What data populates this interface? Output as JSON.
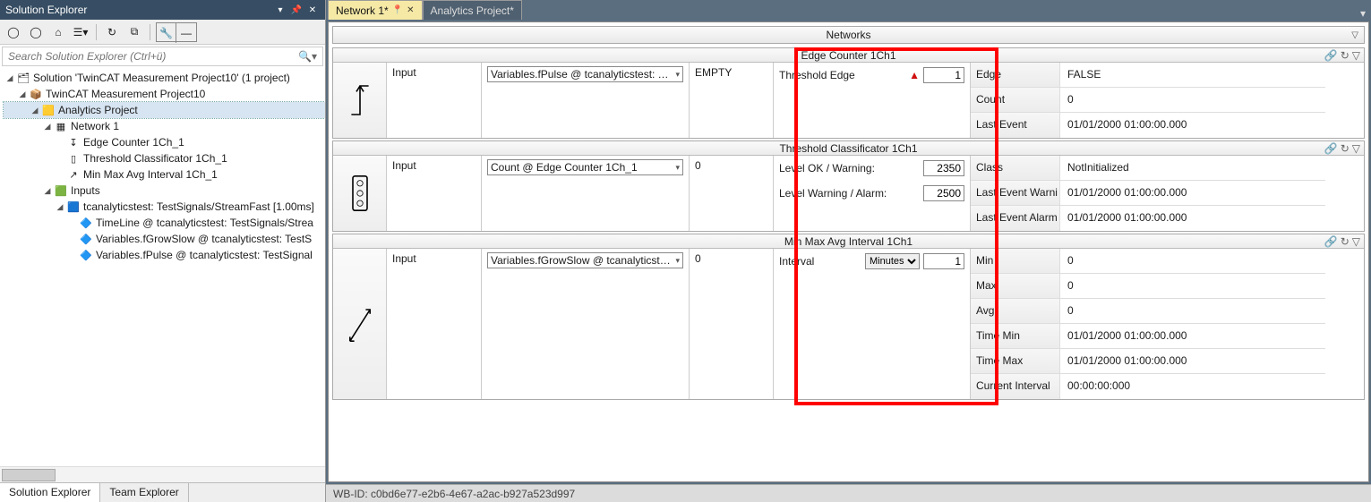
{
  "left_panel": {
    "title": "Solution Explorer",
    "search_placeholder": "Search Solution Explorer (Ctrl+ü)",
    "tree": {
      "root": "Solution 'TwinCAT Measurement Project10' (1 project)",
      "project": "TwinCAT Measurement Project10",
      "analytics": "Analytics Project",
      "network": "Network 1",
      "n1": "Edge Counter 1Ch_1",
      "n2": "Threshold Classificator 1Ch_1",
      "n3": "Min Max Avg Interval 1Ch_1",
      "inputs": "Inputs",
      "stream": "tcanalyticstest: TestSignals/StreamFast [1.00ms]",
      "v1": "TimeLine @ tcanalyticstest: TestSignals/Strea",
      "v2": "Variables.fGrowSlow @ tcanalyticstest: TestS",
      "v3": "Variables.fPulse @ tcanalyticstest: TestSignal"
    },
    "bottom_tabs": {
      "t1": "Solution Explorer",
      "t2": "Team Explorer"
    }
  },
  "doc_tabs": {
    "t1": "Network 1*",
    "t2": "Analytics Project*"
  },
  "networks_header": "Networks",
  "blocks": [
    {
      "title": "Edge Counter 1Ch1",
      "input_label": "Input",
      "input_combo": "Variables.fPulse @ tcanalyticstest: TestSi",
      "mid_value": "EMPTY",
      "params": [
        {
          "label": "Threshold Edge",
          "value": "1",
          "triangle": true
        }
      ],
      "outputs": [
        {
          "name": "Edge",
          "value": "FALSE"
        },
        {
          "name": "Count",
          "value": "0"
        },
        {
          "name": "Last Event",
          "value": "01/01/2000 01:00:00.000"
        }
      ]
    },
    {
      "title": "Threshold Classificator 1Ch1",
      "input_label": "Input",
      "input_combo": "Count @ Edge Counter 1Ch_1",
      "mid_value": "0",
      "params": [
        {
          "label": "Level OK / Warning:",
          "value": "2350"
        },
        {
          "label": "Level Warning / Alarm:",
          "value": "2500"
        }
      ],
      "outputs": [
        {
          "name": "Class",
          "value": "NotInitialized"
        },
        {
          "name": "Last Event Warni",
          "value": "01/01/2000 01:00:00.000"
        },
        {
          "name": "Last Event Alarm",
          "value": "01/01/2000 01:00:00.000"
        }
      ]
    },
    {
      "title": "Min Max Avg Interval 1Ch1",
      "input_label": "Input",
      "input_combo": "Variables.fGrowSlow @ tcanalyticstest: T",
      "mid_value": "0",
      "params": [
        {
          "label": "Interval",
          "select": "Minutes",
          "value": "1"
        }
      ],
      "outputs": [
        {
          "name": "Min",
          "value": "0"
        },
        {
          "name": "Max",
          "value": "0"
        },
        {
          "name": "Avg",
          "value": "0"
        },
        {
          "name": "Time Min",
          "value": "01/01/2000 01:00:00.000"
        },
        {
          "name": "Time Max",
          "value": "01/01/2000 01:00:00.000"
        },
        {
          "name": "Current Interval",
          "value": "00:00:00:000"
        }
      ]
    }
  ],
  "status_bar": "WB-ID: c0bd6e77-e2b6-4e67-a2ac-b927a523d997"
}
